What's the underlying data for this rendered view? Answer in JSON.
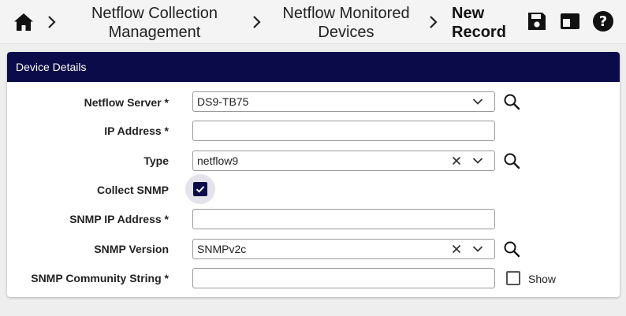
{
  "breadcrumb": {
    "items": [
      {
        "line1": "Netflow Collection",
        "line2": "Management"
      },
      {
        "line1": "Netflow Monitored",
        "line2": "Devices"
      }
    ],
    "current": {
      "line1": "New",
      "line2": "Record"
    }
  },
  "toolbar": {
    "icons": [
      "home-icon",
      "save-icon",
      "panel-toggle-icon",
      "help-icon"
    ]
  },
  "panel": {
    "title": "Device Details"
  },
  "form": {
    "netflow_server": {
      "label": "Netflow Server *",
      "value": "DS9-TB75"
    },
    "ip_address": {
      "label": "IP Address *",
      "value": ""
    },
    "type": {
      "label": "Type",
      "value": "netflow9"
    },
    "collect_snmp": {
      "label": "Collect SNMP",
      "checked": true
    },
    "snmp_ip_address": {
      "label": "SNMP IP Address *",
      "value": ""
    },
    "snmp_version": {
      "label": "SNMP Version",
      "value": "SNMPv2c"
    },
    "snmp_community": {
      "label": "SNMP Community String *",
      "value": "",
      "show_label": "Show"
    }
  },
  "colors": {
    "accent": "#0b0b4a",
    "header_bg": "#f4f4f4",
    "page_bg": "#eeeeee"
  }
}
